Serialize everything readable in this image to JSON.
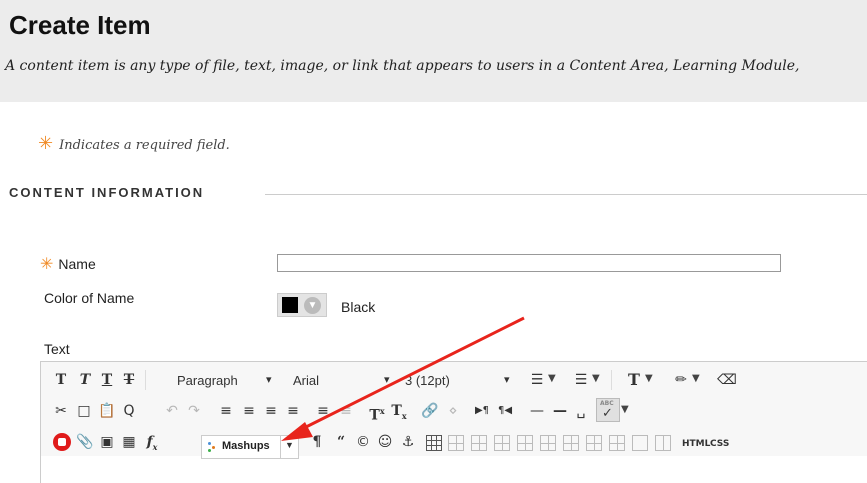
{
  "page": {
    "title": "Create Item",
    "description": "A content item is any type of file, text, image, or link that appears to users in a Content Area, Learning Module,",
    "required_note": "Indicates a required field.",
    "required_star": "✳"
  },
  "section": {
    "title": "CONTENT INFORMATION"
  },
  "form": {
    "name_label": "Name",
    "name_value": "",
    "color_label": "Color of Name",
    "color_value": "Black",
    "text_label": "Text"
  },
  "toolbar": {
    "row1": {
      "format_select": "Paragraph",
      "font_select": "Arial",
      "size_select": "3 (12pt)",
      "caret": "▾"
    },
    "row3": {
      "mashups_label": "Mashups",
      "html_label": "HTML",
      "css_label": "CSS"
    }
  },
  "colors": {
    "header_bg": "#ececec",
    "required_star": "#f08a24",
    "annotation_arrow": "#e8241c"
  }
}
